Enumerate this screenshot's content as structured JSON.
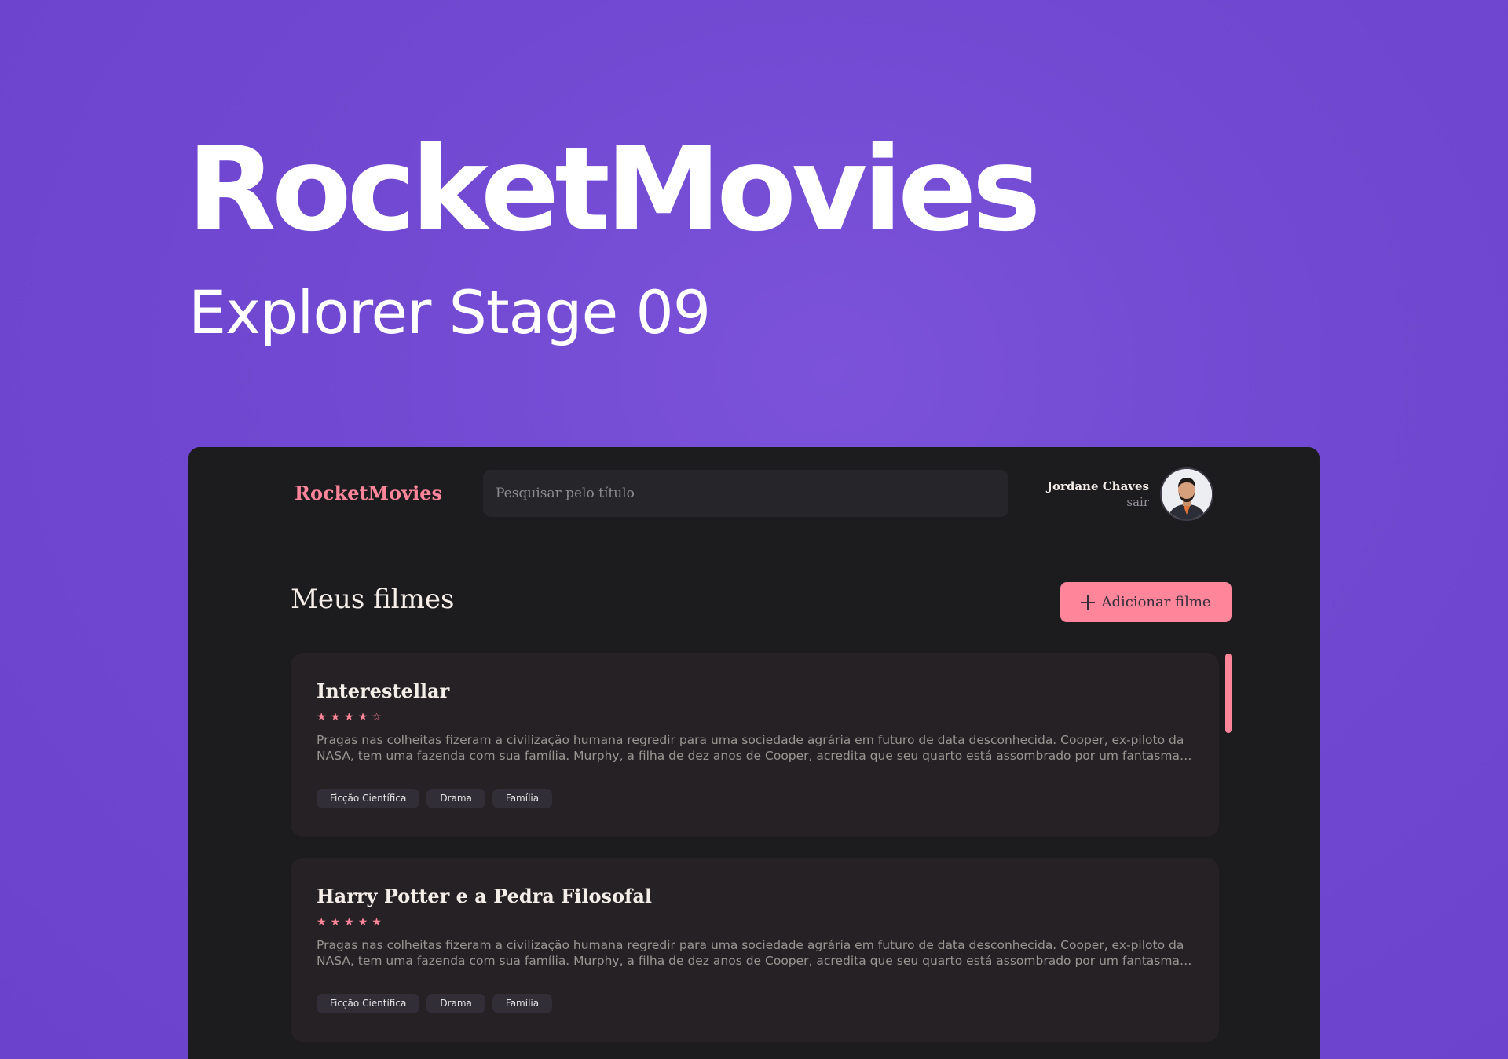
{
  "hero": {
    "title": "RocketMovies",
    "subtitle": "Explorer Stage 09"
  },
  "header": {
    "brand": "RocketMovies",
    "search_placeholder": "Pesquisar pelo título",
    "user_name": "Jordane Chaves",
    "logout_label": "sair"
  },
  "main": {
    "title": "Meus filmes",
    "add_button_label": "Adicionar filme",
    "movies": [
      {
        "title": "Interestellar",
        "rating": 4,
        "rating_max": 5,
        "description": "Pragas nas colheitas fizeram a civilização humana regredir para uma sociedade agrária em futuro de data desconhecida. Cooper, ex-piloto da NASA, tem uma fazenda com sua família. Murphy, a filha de dez anos de Cooper, acredita que seu quarto está assombrado por um fantasma que tenta se comunicar com ela.",
        "tags": [
          "Ficção Científica",
          "Drama",
          "Família"
        ]
      },
      {
        "title": "Harry Potter e a Pedra Filosofal",
        "rating": 5,
        "rating_max": 5,
        "description": "Pragas nas colheitas fizeram a civilização humana regredir para uma sociedade agrária em futuro de data desconhecida. Cooper, ex-piloto da NASA, tem uma fazenda com sua família. Murphy, a filha de dez anos de Cooper, acredita que seu quarto está assombrado por um fantasma que tenta se comunicar com ela.",
        "tags": [
          "Ficção Científica",
          "Drama",
          "Família"
        ]
      }
    ]
  },
  "colors": {
    "accent": "#ff859b",
    "background": "#1c1b1e",
    "card": "#262125",
    "tag": "#312e38"
  }
}
